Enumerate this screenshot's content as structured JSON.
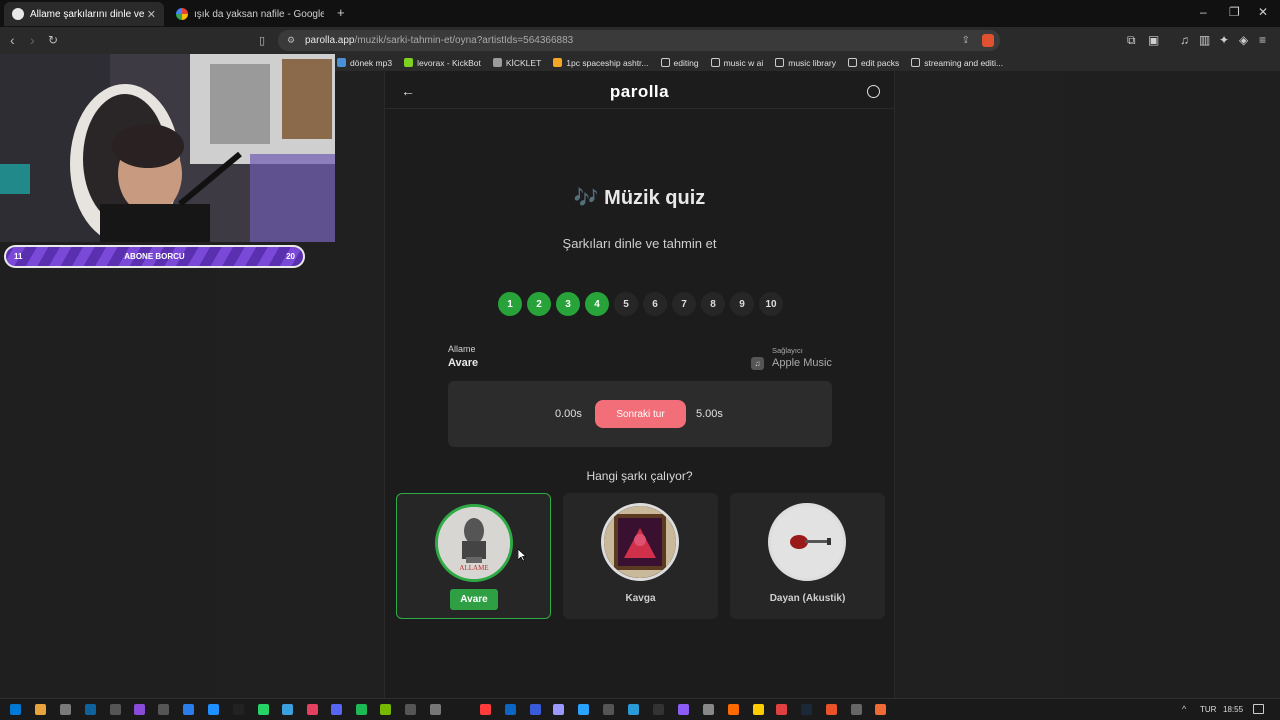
{
  "browser": {
    "tabs": [
      {
        "title": "Allame şarkılarını dinle ve tahmin",
        "active": true
      },
      {
        "title": "ışık da yaksan nafile - Google'da Ara",
        "active": false
      }
    ],
    "url_host": "parolla.app",
    "url_path": "/muzik/sarki-tahmin-et/oyna?artistIds=564366883",
    "bookmarks": [
      "dönek mp3",
      "levorax - KickBot",
      "KİCKLET",
      "1pc spaceship ashtr...",
      "editing",
      "music w ai",
      "music library",
      "edit packs",
      "streaming and editi..."
    ]
  },
  "overlay": {
    "sub_left": "11",
    "sub_label": "ABONE BORCU",
    "sub_right": "20"
  },
  "app": {
    "logo": "parolla",
    "title": "🎶 Müzik quiz",
    "subtitle": "Şarkıları dinle ve tahmin et",
    "rounds": [
      {
        "label": "1",
        "done": true
      },
      {
        "label": "2",
        "done": true
      },
      {
        "label": "3",
        "done": true
      },
      {
        "label": "4",
        "done": true
      },
      {
        "label": "5",
        "done": false
      },
      {
        "label": "6",
        "done": false
      },
      {
        "label": "7",
        "done": false
      },
      {
        "label": "8",
        "done": false
      },
      {
        "label": "9",
        "done": false
      },
      {
        "label": "10",
        "done": false
      }
    ],
    "artist": "Allame",
    "song": "Avare",
    "provider_label": "Sağlayıcı",
    "provider_name": "Apple Music",
    "time_start": "0.00s",
    "next_button": "Sonraki tur",
    "time_end": "5.00s",
    "question": "Hangi şarkı çalıyor?",
    "options": [
      {
        "label": "Avare",
        "correct": true
      },
      {
        "label": "Kavga",
        "correct": false
      },
      {
        "label": "Dayan (Akustik)",
        "correct": false
      }
    ],
    "cover_text": "ALLAME"
  },
  "taskbar": {
    "lang": "TUR",
    "time": "18:55"
  },
  "colors": {
    "accent_green": "#27a33a",
    "button_pink": "#f26f7a"
  }
}
